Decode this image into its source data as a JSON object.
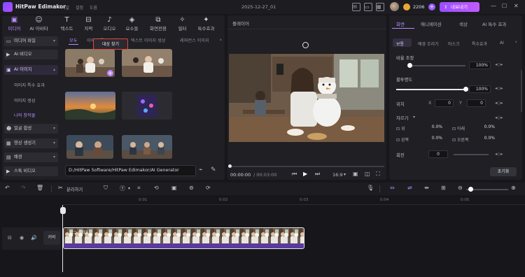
{
  "app": {
    "title": "HitPaw Edimakor",
    "menu": [
      "파일",
      "설정",
      "도움"
    ],
    "doc_title": "2025-12-27_01",
    "credits": "2206",
    "export_label": "내보내기"
  },
  "media": {
    "tabs": [
      "미디어",
      "AI 아바타",
      "텍스트",
      "자막",
      "오디오",
      "요소들",
      "화면전환",
      "필터",
      "특수효과"
    ],
    "sidebar": {
      "media_files": "미디어 파일",
      "ai_video": "AI 비디오",
      "ai_image": "AI 이미지",
      "sub_items": [
        "이미지 특수 효과",
        "이미지 생성",
        "나의 창작물"
      ],
      "bottom_items": [
        "얼굴 합성",
        "영상 생성기",
        "배경",
        "스톡 비디오"
      ]
    },
    "sub_tabs": [
      "모두",
      "이미지 특수 효과",
      "텍스트 이미지 생성",
      "레퍼런스 이미지"
    ],
    "tooltip": "대상 찾기",
    "path": "D:/HitPaw Software/HitPaw Edimakor/AI Generator"
  },
  "player": {
    "title": "플레이어",
    "current_time": "00:00:00",
    "total_time": "/ 00:03:00",
    "aspect": "16:9"
  },
  "properties": {
    "tabs": [
      "화면",
      "애니메이션",
      "색상",
      "AI 특수 효과"
    ],
    "sub_tabs": [
      "보통",
      "배경 흐리기",
      "마스크",
      "특수효과",
      "AI"
    ],
    "scale_label": "비율 조정",
    "scale_value": "100%",
    "scale_level": 0.0,
    "opacity_label": "불투명도",
    "opacity_value": "100%",
    "opacity_level": 1.0,
    "position_label": "위치",
    "pos_x_label": "X",
    "pos_x": "0",
    "pos_y_label": "Y",
    "pos_y": "0",
    "crop_label": "자르기",
    "crop": [
      {
        "label": "위",
        "value": "0.0%"
      },
      {
        "label": "아래",
        "value": "0.0%"
      },
      {
        "label": "왼쪽",
        "value": "0.0%"
      },
      {
        "label": "오른쪽",
        "value": "0.0%"
      }
    ],
    "rotate_label": "회전",
    "rotate_value": "0",
    "reset_label": "초기화"
  },
  "toolbar": {
    "split_label": "분리하기"
  },
  "timeline": {
    "ruler": [
      "0:01",
      "0:02",
      "0:03",
      "0:04",
      "0:05"
    ],
    "track_label": "커버",
    "clip_duration": "0:03"
  },
  "colors": {
    "accent": "#b88cff",
    "export_gradient_start": "#9a4dff",
    "clip_bar": "#5a3a9c"
  }
}
